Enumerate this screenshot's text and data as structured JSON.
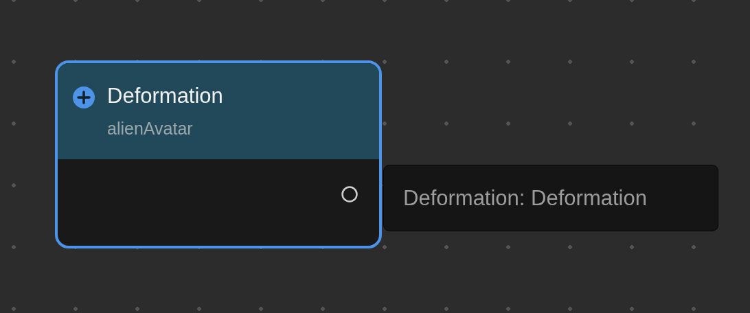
{
  "node": {
    "title": "Deformation",
    "subtitle": "alienAvatar",
    "selected": true
  },
  "output_label": {
    "text": "Deformation: Deformation"
  }
}
